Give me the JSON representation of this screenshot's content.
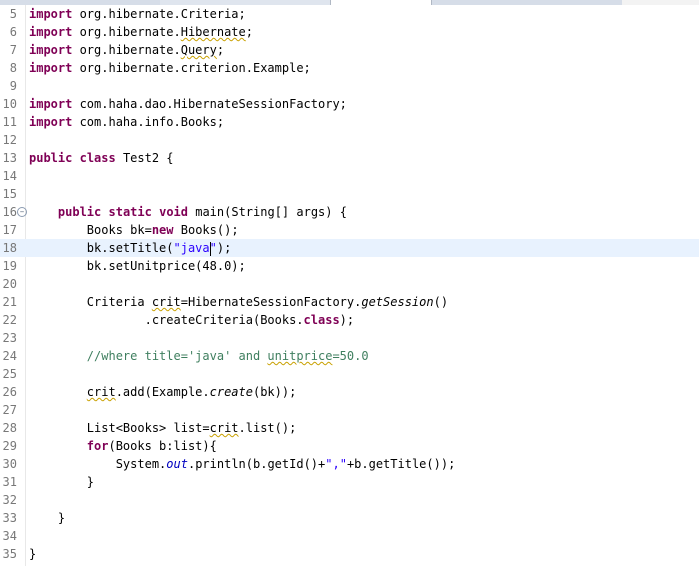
{
  "editor": {
    "current_line": "18",
    "lines": [
      {
        "num": "5",
        "text": "import org.hibernate.Criteria;"
      },
      {
        "num": "6",
        "text": "import org.hibernate.Hibernate;"
      },
      {
        "num": "7",
        "text": "import org.hibernate.Query;"
      },
      {
        "num": "8",
        "text": "import org.hibernate.criterion.Example;"
      },
      {
        "num": "9",
        "text": ""
      },
      {
        "num": "10",
        "text": "import com.haha.dao.HibernateSessionFactory;"
      },
      {
        "num": "11",
        "text": "import com.haha.info.Books;"
      },
      {
        "num": "12",
        "text": ""
      },
      {
        "num": "13",
        "text": "public class Test2 {"
      },
      {
        "num": "14",
        "text": ""
      },
      {
        "num": "15",
        "text": ""
      },
      {
        "num": "16",
        "text": "    public static void main(String[] args) {"
      },
      {
        "num": "17",
        "text": "        Books bk=new Books();"
      },
      {
        "num": "18",
        "text": "        bk.setTitle(\"java\");"
      },
      {
        "num": "19",
        "text": "        bk.setUnitprice(48.0);"
      },
      {
        "num": "20",
        "text": ""
      },
      {
        "num": "21",
        "text": "        Criteria crit=HibernateSessionFactory.getSession()"
      },
      {
        "num": "22",
        "text": "                .createCriteria(Books.class);"
      },
      {
        "num": "23",
        "text": ""
      },
      {
        "num": "24",
        "text": "        //where title='java' and unitprice=50.0"
      },
      {
        "num": "25",
        "text": ""
      },
      {
        "num": "26",
        "text": "        crit.add(Example.create(bk));"
      },
      {
        "num": "27",
        "text": ""
      },
      {
        "num": "28",
        "text": "        List<Books> list=crit.list();"
      },
      {
        "num": "29",
        "text": "        for(Books b:list){"
      },
      {
        "num": "30",
        "text": "            System.out.println(b.getId()+\",\"+b.getTitle());"
      },
      {
        "num": "31",
        "text": "        }"
      },
      {
        "num": "32",
        "text": ""
      },
      {
        "num": "33",
        "text": "    }"
      },
      {
        "num": "34",
        "text": ""
      },
      {
        "num": "35",
        "text": "}"
      }
    ]
  },
  "colors": {
    "keyword": "#7f0055",
    "string": "#2a00ff",
    "comment": "#3f7f5f",
    "current_line_bg": "#e8f2fe",
    "warning_underline": "#c8a000"
  },
  "icons": {
    "fold": "collapse-minus-icon"
  }
}
